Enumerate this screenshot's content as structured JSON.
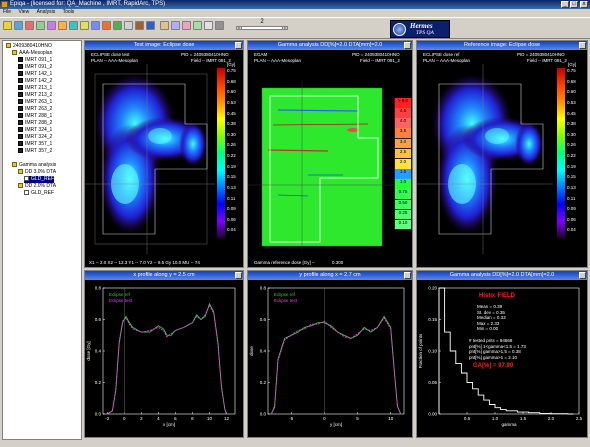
{
  "window": {
    "title": "Epiqa - (licensed for: QA_Machine , IMRT, RapidArc, TPS)",
    "minimize": "_",
    "maximize": "□",
    "close": "x"
  },
  "menu": [
    "File",
    "View",
    "Analysis",
    "Tools"
  ],
  "toolbar": {
    "page_number": "2",
    "pager_prev": "<",
    "pager_next": ">",
    "logo_title": "Hermes",
    "logo_sub": "TPS QA"
  },
  "tree": {
    "root": "2409380410HNO",
    "plan": "AAA-Mesoplan",
    "beams": [
      "IMRT 091_1",
      "IMRT 091_2",
      "IMRT 142_1",
      "IMRT 142_2",
      "IMRT 213_1",
      "IMRT 213_2",
      "IMRT 263_1",
      "IMRT 263_2",
      "IMRT 288_1",
      "IMRT 288_2",
      "IMRT 324_1",
      "IMRT 324_2",
      "IMRT 357_1",
      "IMRT 357_2"
    ],
    "analysis": "Gamma analysis",
    "dd1": "DD 3.0% DTA",
    "dd1_item": "GLD_REF",
    "dd2": "DD 2.0% DTA",
    "dd2_item": "GLD_REF"
  },
  "panels": {
    "test": {
      "title": "Test image: Eclipse dose",
      "line1_left": "ECLIPSE dose test",
      "line1_right": "PID = 2409380410HNO",
      "line2_left": "PLAN -- AAA-Mesoplan",
      "line2_right": "Field -- IMRT 091_2",
      "unit": "[Gy]",
      "scale": [
        "0.75",
        "0.68",
        "0.60",
        "0.53",
        "0.45",
        "0.38",
        "0.30",
        "0.26",
        "0.22",
        "0.19",
        "0.15",
        "0.13",
        "0.11",
        "0.09",
        "0.06",
        "0.04"
      ],
      "footer": "X1 -- 2.0  X2 -- 12.3  Y1 -- 7.0  Y2 -- 9.5  Gy   10.0   MU -- 74"
    },
    "gamma": {
      "title": "Gamma analysis DD[%]=2.0 DTA[mm]=2.0",
      "line1_left": "EGAM",
      "line1_right": "PID = 2409380410HNO",
      "line2_left": "PLAN -- AAA-Mesoplan",
      "line2_right": "Field -- IMRT 091_2",
      "scale": [
        "> 5.0",
        "4.5",
        "4.0",
        "3.5",
        "3.0",
        "2.5",
        "2.0",
        "1.5",
        "1.0",
        "0.75",
        "0.50",
        "0.25",
        "0.10"
      ],
      "footer_label": "Gamma reference dose [Gy] --",
      "footer_value": "0.300"
    },
    "reference": {
      "title": "Reference image: Eclipse dose",
      "line1_left": "ECLIPSE dose ref",
      "line1_right": "PID = 2409380410HNO",
      "line2_left": "PLAN -- AAA-Mesoplan",
      "line2_right": "Field -- IMRT 091_2",
      "unit": "[Gy]",
      "scale": [
        "0.75",
        "0.68",
        "0.60",
        "0.53",
        "0.45",
        "0.38",
        "0.30",
        "0.26",
        "0.22",
        "0.19",
        "0.15",
        "0.13",
        "0.11",
        "0.09",
        "0.06",
        "0.04"
      ]
    },
    "xprofile": {
      "title": "x profile along y = 2.5 cm",
      "legend_ref": "Eclipse ref",
      "legend_test": "Eclipse test",
      "ylabel": "dose [Gy]",
      "xlabel": "x [cm]",
      "yticks": [
        "0.8",
        "0.6",
        "0.4",
        "0.2",
        "0.0"
      ],
      "xticks": [
        "-2",
        "0",
        "2",
        "4",
        "6",
        "8",
        "10",
        "12"
      ]
    },
    "yprofile": {
      "title": "y profile along x = 2.7 cm",
      "legend_ref": "Eclipse ref",
      "legend_test": "Eclipse test",
      "ylabel": "dose",
      "xlabel": "y [cm]",
      "yticks": [
        "0.8",
        "0.6",
        "0.4",
        "0.2",
        "0.0"
      ],
      "xticks": [
        "-5",
        "0",
        "5",
        "10"
      ]
    },
    "histo": {
      "title": "Gamma analysis DD[%]=2.0 DTA[mm]=2.0",
      "heading": "Histo: FIELD",
      "stats": [
        "Mean =   0.39",
        "St. dev =   0.35",
        "Median =   0.33",
        "Max =   2.33",
        "Min =   0.00"
      ],
      "tests": [
        "# tested pnts = 94668",
        "pnt[%] 1<gamma<1.5 = 1.73",
        "pnt[%] gamma>1.5 = 0.38",
        "pnt[%] gamma>1 = 2.10"
      ],
      "pass_label": "GA[%] = 97.90",
      "ylabel": "Fraction of points",
      "xlabel": "gamma",
      "yticks": [
        "0.20",
        "0.15",
        "0.10",
        "0.05",
        "0.00"
      ],
      "xticks": [
        "0.5",
        "1.0",
        "1.5",
        "2.0",
        "2.5"
      ]
    }
  },
  "colors": {
    "accent": "#1040c0",
    "ref_curve": "#30d030",
    "test_curve": "#ff30ff",
    "histo_title": "#ff2020"
  },
  "chart_data": [
    {
      "type": "line",
      "title": "x profile along y = 2.5 cm",
      "xlabel": "x [cm]",
      "ylabel": "dose [Gy]",
      "ylim": [
        0,
        0.8
      ],
      "series": [
        {
          "name": "Eclipse ref",
          "x": [
            -2,
            -1.4,
            -1,
            -0.6,
            -0.2,
            0.2,
            0.6,
            1,
            2,
            3,
            4,
            4.6,
            5,
            5.5,
            6,
            7,
            8,
            8.5,
            9,
            9.5,
            10,
            10.5,
            11,
            11.4,
            11.8,
            12
          ],
          "y": [
            0.0,
            0.02,
            0.15,
            0.45,
            0.58,
            0.62,
            0.58,
            0.55,
            0.52,
            0.52,
            0.56,
            0.54,
            0.5,
            0.5,
            0.53,
            0.55,
            0.58,
            0.63,
            0.6,
            0.62,
            0.7,
            0.65,
            0.45,
            0.18,
            0.03,
            0.0
          ]
        },
        {
          "name": "Eclipse test",
          "x": [
            -2,
            -1.4,
            -1,
            -0.6,
            -0.2,
            0.2,
            0.6,
            1,
            2,
            3,
            4,
            4.6,
            5,
            5.5,
            6,
            7,
            8,
            8.5,
            9,
            9.5,
            10,
            10.5,
            11,
            11.4,
            11.8,
            12
          ],
          "y": [
            0.0,
            0.02,
            0.16,
            0.46,
            0.59,
            0.61,
            0.57,
            0.54,
            0.52,
            0.53,
            0.55,
            0.53,
            0.49,
            0.51,
            0.53,
            0.55,
            0.58,
            0.62,
            0.6,
            0.63,
            0.69,
            0.64,
            0.44,
            0.17,
            0.03,
            0.0
          ]
        }
      ]
    },
    {
      "type": "line",
      "title": "y profile along x = 2.7 cm",
      "xlabel": "y [cm]",
      "ylabel": "dose",
      "ylim": [
        0,
        0.8
      ],
      "series": [
        {
          "name": "Eclipse ref",
          "x": [
            -8,
            -7.5,
            -7,
            -6,
            -5,
            -4,
            -3,
            -2,
            -1,
            0,
            1,
            2,
            3,
            4,
            5,
            6,
            7,
            8,
            9,
            10,
            10.5,
            11,
            11.5
          ],
          "y": [
            0.0,
            0.05,
            0.35,
            0.48,
            0.5,
            0.52,
            0.55,
            0.56,
            0.58,
            0.58,
            0.56,
            0.52,
            0.5,
            0.48,
            0.5,
            0.55,
            0.52,
            0.55,
            0.62,
            0.55,
            0.3,
            0.05,
            0.0
          ]
        },
        {
          "name": "Eclipse test",
          "x": [
            -8,
            -7.5,
            -7,
            -6,
            -5,
            -4,
            -3,
            -2,
            -1,
            0,
            1,
            2,
            3,
            4,
            5,
            6,
            7,
            8,
            9,
            10,
            10.5,
            11,
            11.5
          ],
          "y": [
            0.0,
            0.04,
            0.34,
            0.47,
            0.5,
            0.53,
            0.54,
            0.57,
            0.57,
            0.59,
            0.55,
            0.52,
            0.49,
            0.48,
            0.51,
            0.54,
            0.53,
            0.55,
            0.61,
            0.54,
            0.29,
            0.05,
            0.0
          ]
        }
      ]
    },
    {
      "type": "line",
      "title": "Gamma analysis DD[%]=2.0 DTA[mm]=2.0",
      "xlabel": "gamma",
      "ylabel": "Fraction of points",
      "ylim": [
        0,
        0.2
      ],
      "x": [
        0,
        0.1,
        0.2,
        0.3,
        0.4,
        0.5,
        0.6,
        0.7,
        0.8,
        0.9,
        1.0,
        1.1,
        1.2,
        1.4,
        1.6,
        1.8,
        2.0,
        2.3
      ],
      "values": [
        0.2,
        0.13,
        0.1,
        0.08,
        0.065,
        0.05,
        0.04,
        0.03,
        0.022,
        0.015,
        0.01,
        0.007,
        0.005,
        0.003,
        0.002,
        0.001,
        0.0005,
        0.0
      ]
    }
  ]
}
